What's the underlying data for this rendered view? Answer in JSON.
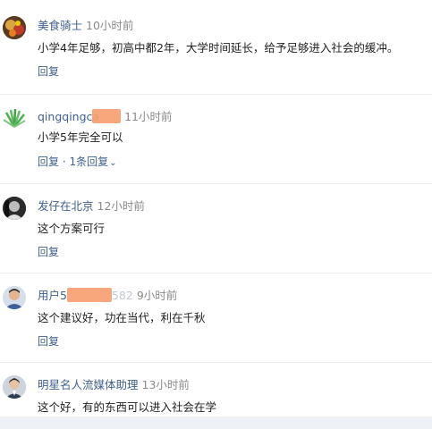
{
  "comments": [
    {
      "username": "美食骑士",
      "time": "10小时前",
      "text": "小学4年足够，初高中都2年，大学时间延长，给予足够进入社会的缓冲。",
      "actions": "回复"
    },
    {
      "username": "qingqingca",
      "time": "11小时前",
      "text": "小学5年完全可以",
      "actions": "回复 · 1条回复",
      "has_replies": true
    },
    {
      "username": "发仔在北京",
      "time": "12小时前",
      "text": "这个方案可行",
      "actions": "回复"
    },
    {
      "username": "用户5",
      "username_tail": "582",
      "time": "9小时前",
      "text": "这个建议好，功在当代，利在千秋",
      "actions": "回复"
    },
    {
      "username": "明星名人流媒体助理",
      "time": "13小时前",
      "text": "这个好，有的东西可以进入社会在学"
    }
  ],
  "icons": {
    "expand": "chevron-down-icon"
  },
  "colors": {
    "username": "#40608c",
    "time": "#8a8a8a",
    "text": "#222222",
    "redaction": "#f6a070",
    "divider": "#e8ebf0"
  }
}
